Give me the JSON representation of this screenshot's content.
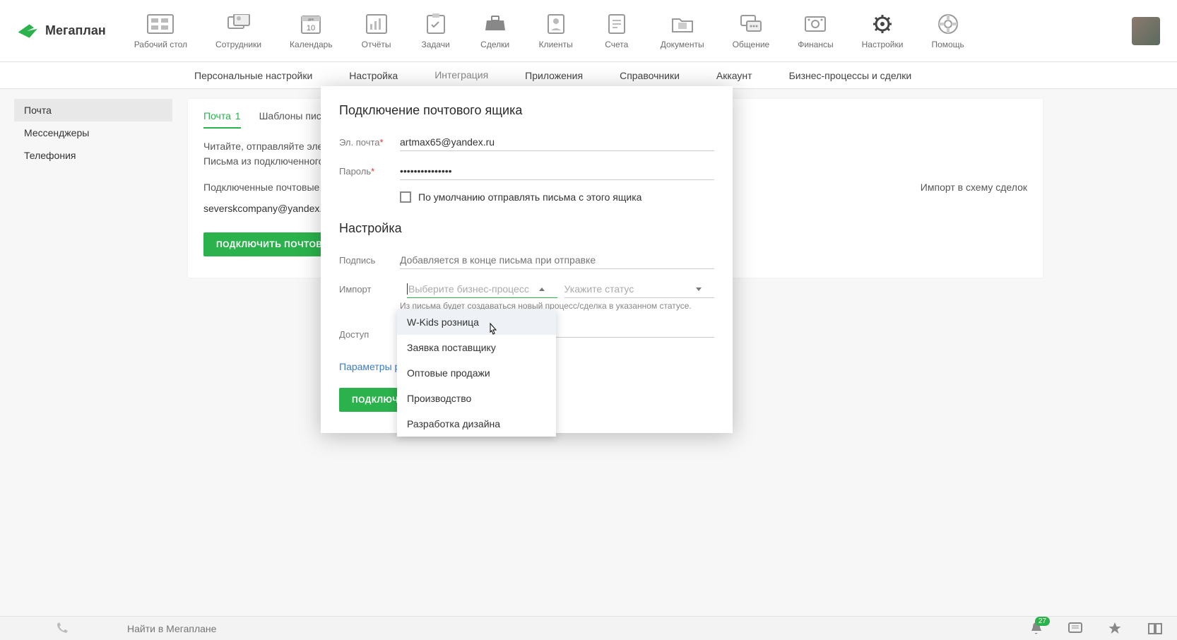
{
  "brand": "Мегаплан",
  "nav": [
    {
      "label": "Рабочий стол"
    },
    {
      "label": "Сотрудники"
    },
    {
      "label": "Календарь"
    },
    {
      "label": "Отчёты"
    },
    {
      "label": "Задачи"
    },
    {
      "label": "Сделки"
    },
    {
      "label": "Клиенты"
    },
    {
      "label": "Счета"
    },
    {
      "label": "Документы"
    },
    {
      "label": "Общение"
    },
    {
      "label": "Финансы"
    },
    {
      "label": "Настройки"
    },
    {
      "label": "Помощь"
    }
  ],
  "subnav": [
    "Персональные настройки",
    "Настройка",
    "Интеграция",
    "Приложения",
    "Справочники",
    "Аккаунт",
    "Бизнес-процессы и сделки"
  ],
  "subnav_active": 2,
  "sidebar": [
    "Почта",
    "Мессенджеры",
    "Телефония"
  ],
  "sidebar_active": 0,
  "main_tabs": {
    "tab1": "Почта",
    "tab1_count": "1",
    "tab2": "Шаблоны писем"
  },
  "desc_line1": "Читайте, отправляйте электронные письма прямо из Мегаплана.",
  "desc_line2": "Письма из подключенного ящика будут прикрепляться к клиентам.",
  "connected_header": "Подключенные почтовые ящики",
  "import_scheme": "Импорт в схему сделок",
  "connected_email": "severskcompany@yandex.ru",
  "connect_btn": "ПОДКЛЮЧИТЬ ПОЧТОВЫЙ ЯЩИК",
  "modal": {
    "title": "Подключение почтового ящика",
    "email_label": "Эл. почта",
    "email_value": "artmax65@yandex.ru",
    "password_label": "Пароль",
    "password_value": "•••••••••••••••",
    "default_send": "По умолчанию отправлять письма с этого ящика",
    "settings_title": "Настройка",
    "signature_label": "Подпись",
    "signature_placeholder": "Добавляется в конце письма при отправке",
    "import_label": "Импорт",
    "process_placeholder": "Выберите бизнес-процесс",
    "status_placeholder": "Укажите статус",
    "import_help": "Из письма будет создаваться новый процесс/сделка в указанном статусе.",
    "access_label": "Доступ",
    "manual_params": "Параметры ручной настройки",
    "submit": "ПОДКЛЮЧИТЬ"
  },
  "dropdown": [
    "W-Kids розница",
    "Заявка поставщику",
    "Оптовые продажи",
    "Производство",
    "Разработка дизайна"
  ],
  "dropdown_highlight": 0,
  "bottom": {
    "search_placeholder": "Найти в Мегаплане",
    "notif_count": "27"
  }
}
